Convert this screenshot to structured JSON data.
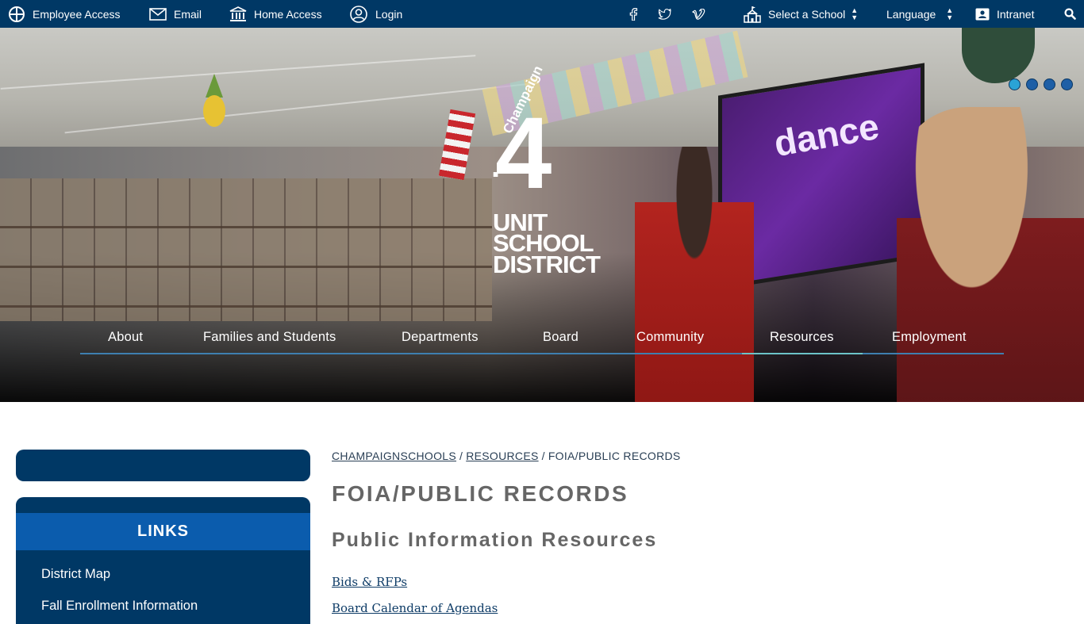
{
  "topbar": {
    "employee_access": "Employee Access",
    "email": "Email",
    "home_access": "Home Access",
    "login": "Login",
    "select_school": "Select a School",
    "language": "Language",
    "intranet": "Intranet",
    "background_color": "#003865"
  },
  "logo": {
    "champaign": "Champaign",
    "number": "4",
    "line1": "UNIT",
    "line2": "SCHOOL",
    "line3": "DISTRICT"
  },
  "hero": {
    "screen_text": "dance",
    "carousel_dots": 4,
    "active_dot": 1
  },
  "mainnav": {
    "items": [
      "About",
      "Families and Students",
      "Departments",
      "Board",
      "Community",
      "Resources",
      "Employment"
    ],
    "active": "Resources"
  },
  "sidebar": {
    "heading": "LINKS",
    "links": [
      "District Map",
      "Fall Enrollment Information"
    ]
  },
  "breadcrumb": {
    "home": "CHAMPAIGNSCHOOLS",
    "section": "RESOURCES",
    "current": "FOIA/PUBLIC RECORDS",
    "separator": "/"
  },
  "main": {
    "title": "FOIA/PUBLIC RECORDS",
    "subtitle": "Public Information Resources",
    "links": [
      "Bids & RFPs",
      "Board Calendar of Agendas"
    ]
  },
  "colors": {
    "brand_navy": "#003865",
    "sidebar_header": "#0b5cad",
    "nav_active": "#6cc3c8",
    "heading_gray": "#666666"
  }
}
